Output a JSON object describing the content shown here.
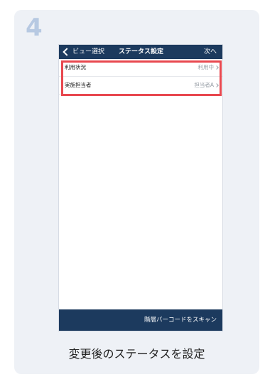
{
  "step": {
    "number": "4"
  },
  "navbar": {
    "back_label": "ビュー選択",
    "title": "ステータス設定",
    "next_label": "次へ"
  },
  "list": {
    "items": [
      {
        "label": "利用状況",
        "value": "利用中"
      },
      {
        "label": "実施担当者",
        "value": "担当者A"
      }
    ]
  },
  "bottom_bar": {
    "label": "階層バーコードをスキャン"
  },
  "caption": "変更後のステータスを設定",
  "colors": {
    "navbar": "#1c3a5e",
    "highlight": "#e8484f",
    "step_number": "#b7c9e2",
    "card_background": "#eef1f6"
  }
}
